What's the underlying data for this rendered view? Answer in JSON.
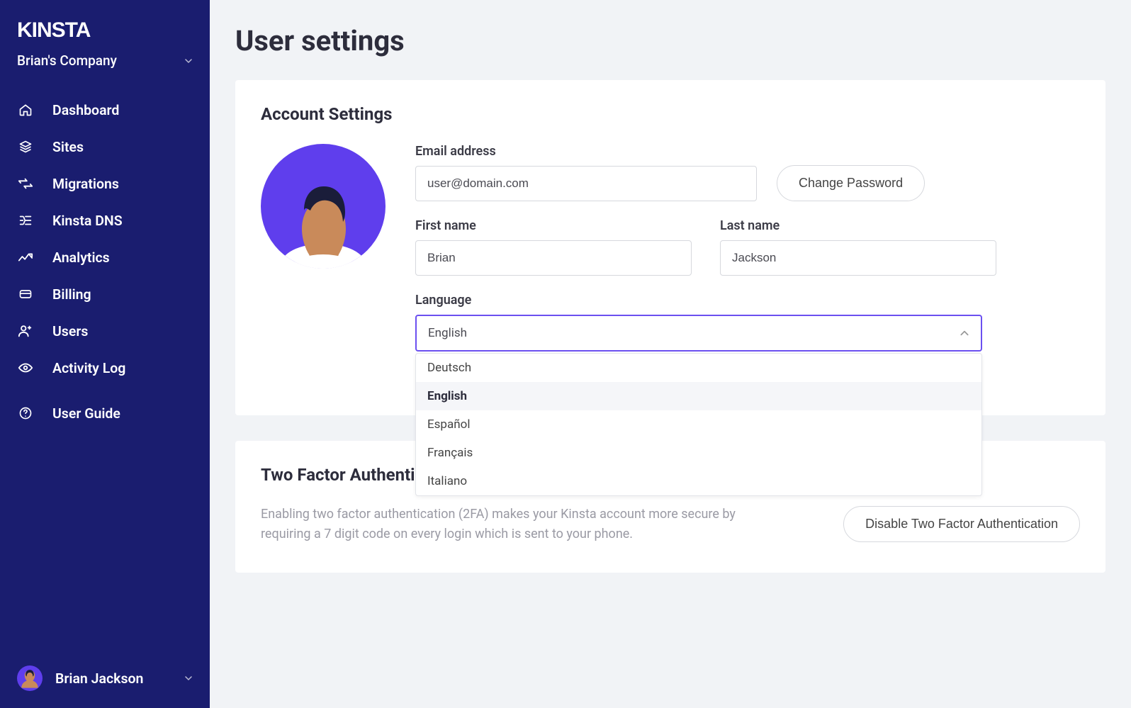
{
  "brand": {
    "logo": "KINSTA"
  },
  "company": {
    "name": "Brian's Company"
  },
  "sidebar": {
    "items": [
      {
        "label": "Dashboard"
      },
      {
        "label": "Sites"
      },
      {
        "label": "Migrations"
      },
      {
        "label": "Kinsta DNS"
      },
      {
        "label": "Analytics"
      },
      {
        "label": "Billing"
      },
      {
        "label": "Users"
      },
      {
        "label": "Activity Log"
      },
      {
        "label": "User Guide"
      }
    ]
  },
  "footer_user": {
    "name": "Brian Jackson"
  },
  "page": {
    "title": "User settings"
  },
  "account": {
    "heading": "Account Settings",
    "email_label": "Email address",
    "email_value": "user@domain.com",
    "change_password_label": "Change Password",
    "firstname_label": "First name",
    "firstname_value": "Brian",
    "lastname_label": "Last name",
    "lastname_value": "Jackson",
    "language_label": "Language",
    "language_selected": "English",
    "language_options": {
      "0": "Deutsch",
      "1": "English",
      "2": "Español",
      "3": "Français",
      "4": "Italiano"
    }
  },
  "tfa": {
    "heading_visible": "Two Factor Authenti",
    "description": "Enabling two factor authentication (2FA) makes your Kinsta account more secure by requiring a 7 digit code on every login which is sent to your phone.",
    "button_label": "Disable Two Factor Authentication"
  }
}
